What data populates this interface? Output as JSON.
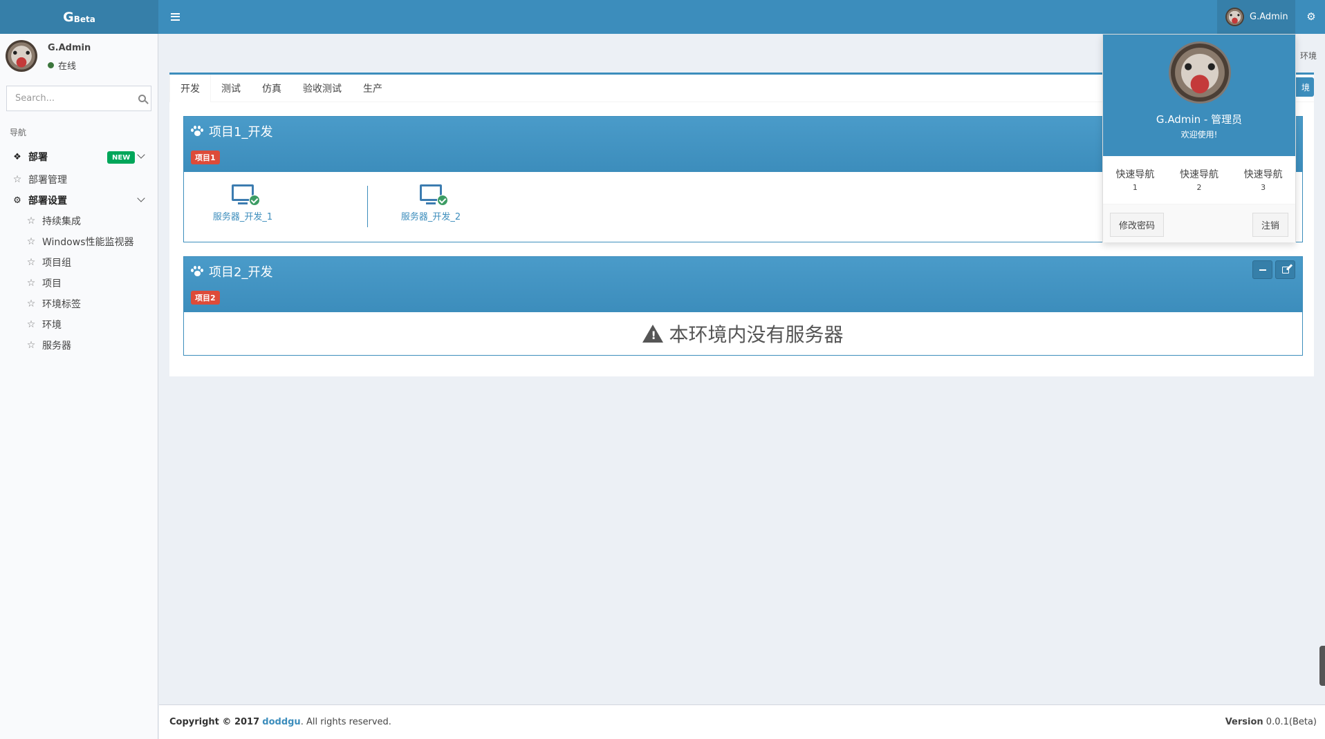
{
  "header": {
    "logo_main": "G",
    "logo_sub": "Beta",
    "user_name": "G.Admin"
  },
  "sidebar": {
    "user_name": "G.Admin",
    "status": "在线",
    "search_placeholder": "Search...",
    "nav_header": "导航",
    "menu": {
      "deploy": "部署",
      "deploy_badge": "NEW",
      "deploy_manage": "部署管理",
      "deploy_settings": "部署设置",
      "sub_items": [
        "持续集成",
        "Windows性能监视器",
        "项目组",
        "项目",
        "环境标签",
        "环境",
        "服务器"
      ]
    }
  },
  "tabs": [
    "开发",
    "测试",
    "仿真",
    "验收测试",
    "生产"
  ],
  "tabs_right_text": "环境",
  "tab_button_text": "境",
  "projects": [
    {
      "title": "项目1_开发",
      "label": "项目1",
      "servers": [
        "服务器_开发_1",
        "服务器_开发_2"
      ]
    },
    {
      "title": "项目2_开发",
      "label": "项目2",
      "empty_message": "本环境内没有服务器"
    }
  ],
  "dropdown": {
    "name": "G.Admin - 管理员",
    "welcome": "欢迎使用!",
    "quick_nav": [
      {
        "label": "快速导航",
        "num": "1"
      },
      {
        "label": "快速导航",
        "num": "2"
      },
      {
        "label": "快速导航",
        "num": "3"
      }
    ],
    "change_password": "修改密码",
    "logout": "注销"
  },
  "footer": {
    "copyright": "Copyright © 2017",
    "company": "doddgu",
    "rights": ". All rights reserved.",
    "version_label": "Version",
    "version_value": "0.0.1(Beta)"
  },
  "colors": {
    "primary": "#3c8dbc",
    "danger": "#dd4b39",
    "success": "#00a65a"
  }
}
